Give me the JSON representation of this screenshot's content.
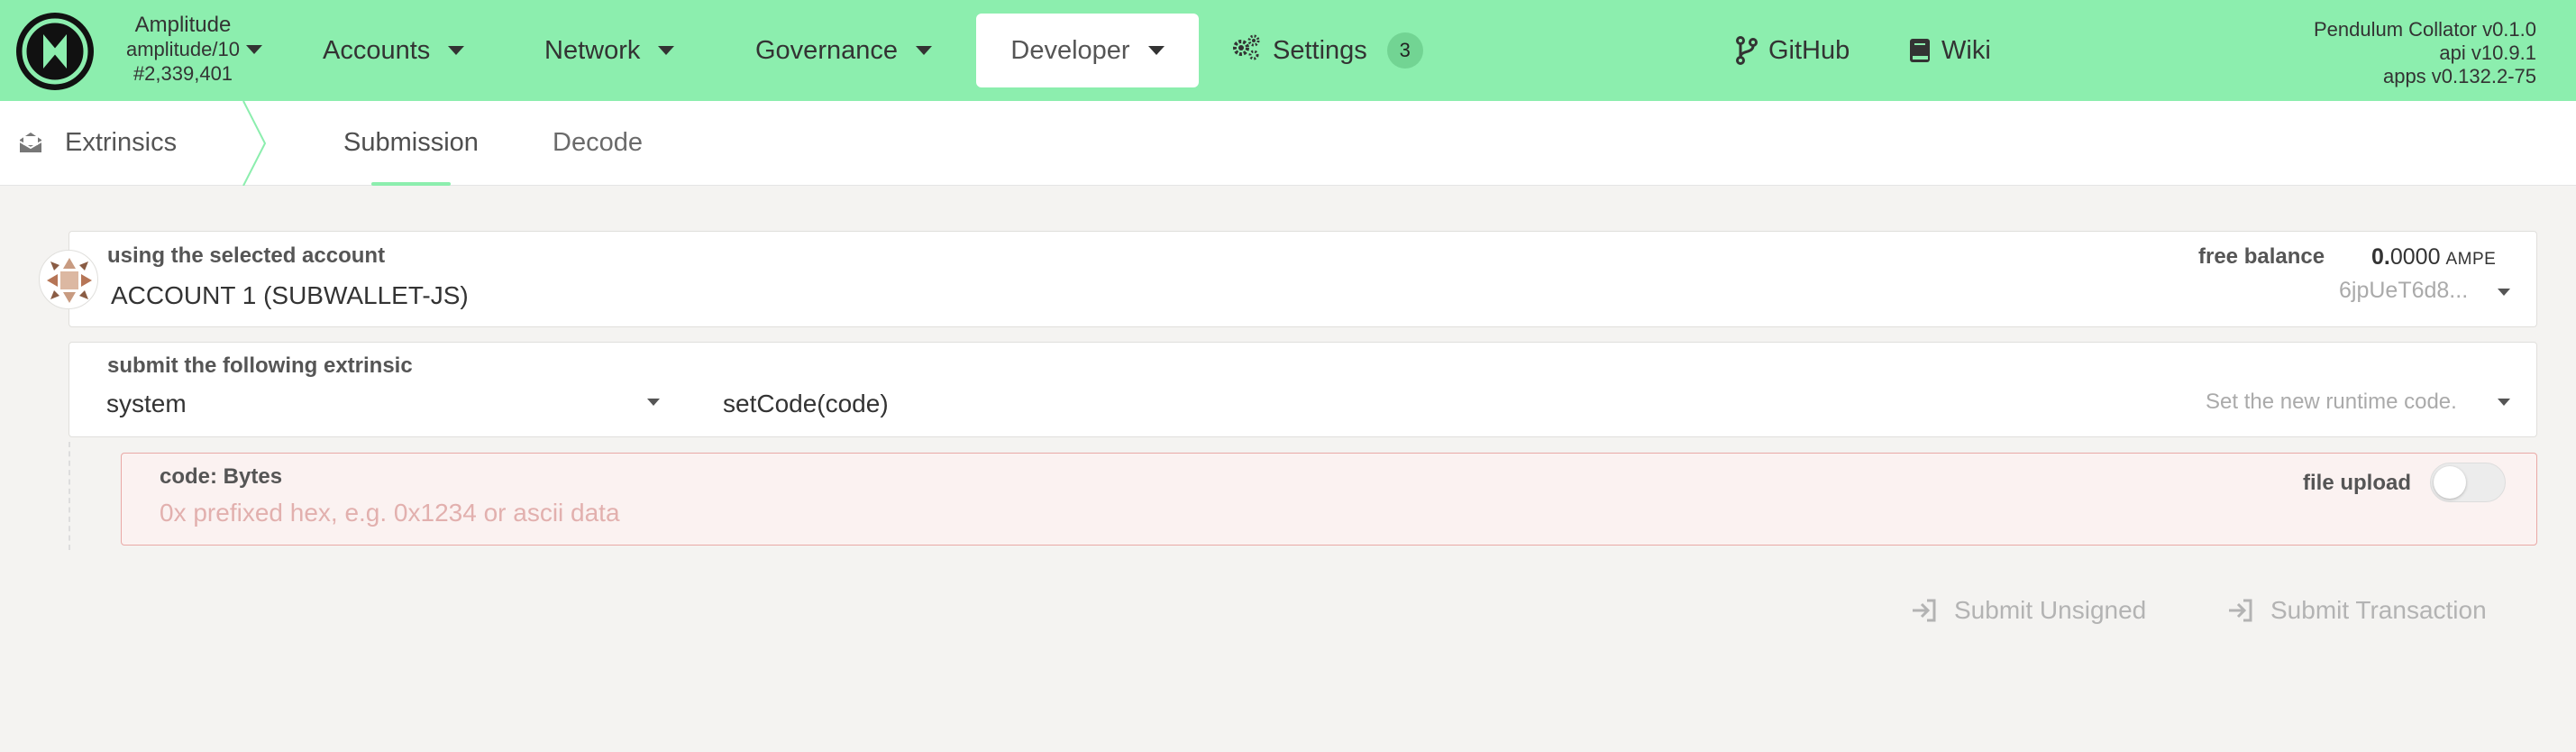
{
  "colors": {
    "accent": "#8ceeae",
    "badge": "#72d493",
    "error_bg": "#fbf2f1",
    "error_border": "#e9a9a6"
  },
  "header": {
    "chain_name": "Amplitude",
    "chain_spec": "amplitude/10",
    "block": "#2,339,401",
    "nav": {
      "accounts": "Accounts",
      "network": "Network",
      "governance": "Governance",
      "developer": "Developer",
      "settings": "Settings",
      "settings_badge": "3",
      "github": "GitHub",
      "wiki": "Wiki"
    },
    "versions": {
      "node": "Pendulum Collator v0.1.0",
      "api": "api v10.9.1",
      "apps": "apps v0.132.2-75"
    }
  },
  "subnav": {
    "section": "Extrinsics",
    "tabs": [
      "Submission",
      "Decode"
    ],
    "active_tab": "Submission"
  },
  "account": {
    "label": "using the selected account",
    "name": "ACCOUNT 1 (SUBWALLET-JS)",
    "balance_label": "free balance",
    "balance_int": "0.",
    "balance_dec": "0000",
    "balance_unit": "AMPE",
    "address": "6jpUeT6d8..."
  },
  "extrinsic": {
    "label": "submit the following extrinsic",
    "section": "system",
    "method": "setCode(code)",
    "method_doc": "Set the new runtime code."
  },
  "param": {
    "label": "code: Bytes",
    "placeholder": "0x prefixed hex, e.g. 0x1234 or ascii data",
    "file_upload_label": "file upload",
    "file_upload_on": false
  },
  "actions": {
    "submit_unsigned": "Submit Unsigned",
    "submit_transaction": "Submit Transaction"
  }
}
